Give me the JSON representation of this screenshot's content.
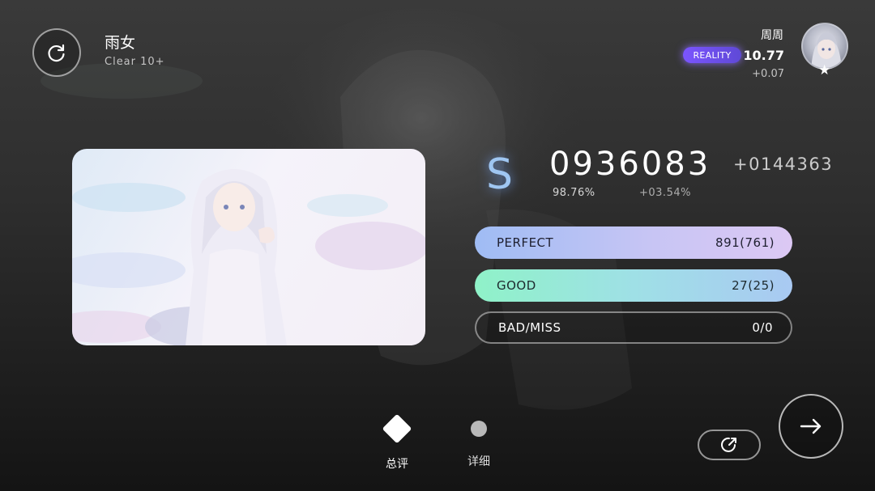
{
  "song": {
    "title": "雨女",
    "level": "Clear 10+"
  },
  "player": {
    "name": "周周",
    "badge": "REALITY",
    "rks": "10.77",
    "rks_delta": "+0.07"
  },
  "result": {
    "grade": "S",
    "score": "0936083",
    "score_delta": "+0144363",
    "accuracy": "98.76%",
    "accuracy_delta": "+03.54%"
  },
  "judgements": [
    {
      "label": "PERFECT",
      "value": "891(761)"
    },
    {
      "label": "GOOD",
      "value": "27(25)"
    },
    {
      "label": "BAD/MISS",
      "value": "0/0"
    }
  ],
  "tabs": [
    {
      "label": "总评",
      "active": true
    },
    {
      "label": "详细",
      "active": false
    }
  ],
  "icons": {
    "retry": "retry-icon",
    "share": "share-icon",
    "next": "arrow-right-icon",
    "star": "star-icon"
  },
  "colors": {
    "perfect_start": "#9fbcf4",
    "perfect_end": "#dcc8f4",
    "good_start": "#8ff2c8",
    "good_end": "#a9c9f2",
    "reality_badge": "#7b55ff",
    "grade": "#9fc6f2"
  }
}
